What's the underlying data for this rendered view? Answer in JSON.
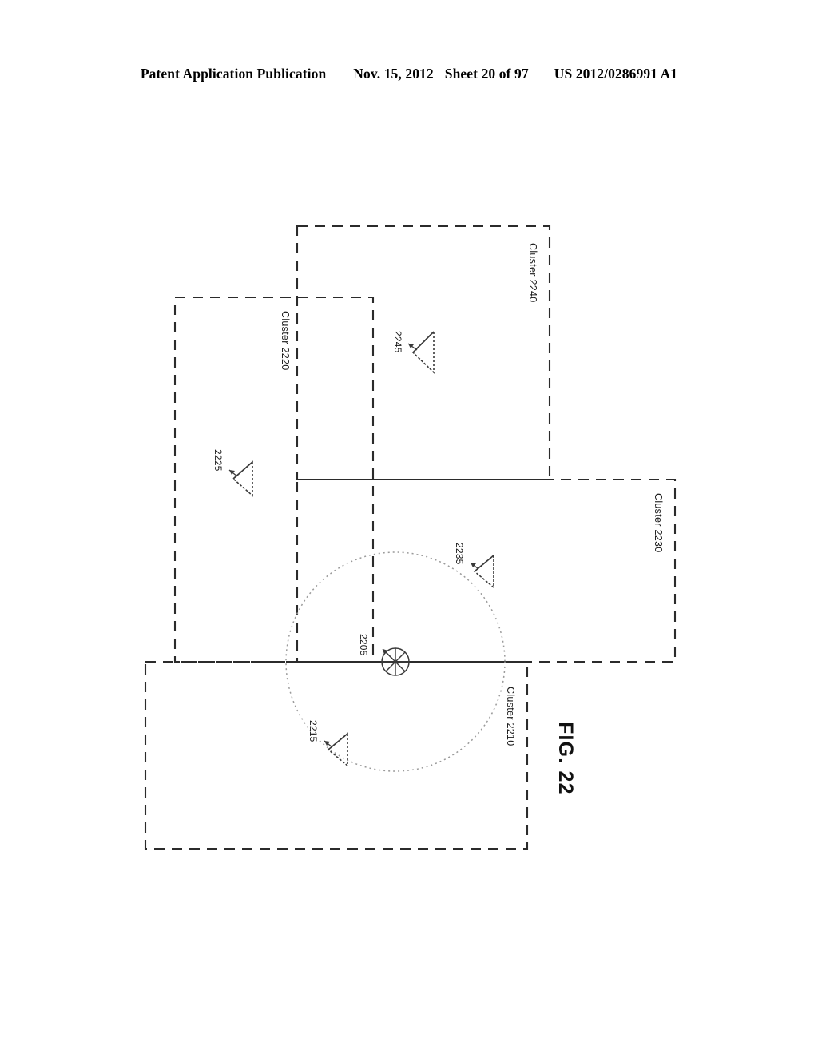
{
  "header": {
    "publication_type": "Patent Application Publication",
    "date": "Nov. 15, 2012",
    "sheet": "Sheet 20 of 97",
    "patent_number": "US 2012/0286991 A1"
  },
  "figure": {
    "caption": "FIG. 22",
    "clusters": [
      {
        "id": "cluster-2240",
        "label": "Cluster 2240"
      },
      {
        "id": "cluster-2220",
        "label": "Cluster 2220"
      },
      {
        "id": "cluster-2230",
        "label": "Cluster 2230"
      },
      {
        "id": "cluster-2210",
        "label": "Cluster 2210"
      }
    ],
    "nodes": [
      {
        "id": "node-2245",
        "label": "2245",
        "symbol": "antenna-triangle-icon"
      },
      {
        "id": "node-2225",
        "label": "2225",
        "symbol": "antenna-triangle-icon"
      },
      {
        "id": "node-2235",
        "label": "2235",
        "symbol": "antenna-triangle-icon"
      },
      {
        "id": "node-2215",
        "label": "2215",
        "symbol": "antenna-triangle-icon"
      }
    ],
    "mobile_device": {
      "id": "node-2205",
      "label": "2205",
      "symbol": "wheel-circle-icon"
    },
    "coverage_circle": {
      "id": "coverage-2205",
      "label": ""
    }
  }
}
